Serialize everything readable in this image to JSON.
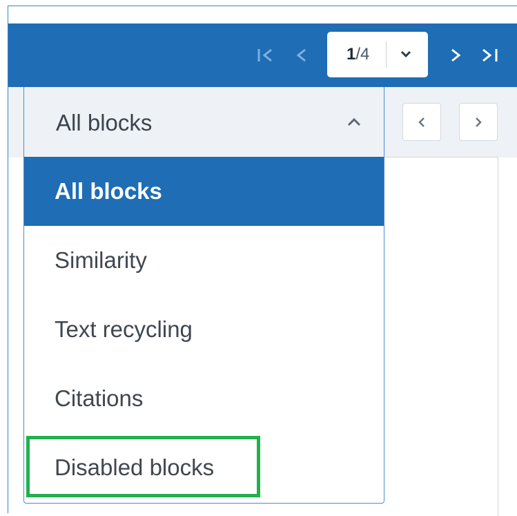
{
  "toolbar": {
    "page_current": "1",
    "page_total": "/4",
    "first_page_icon": "first-page-icon",
    "prev_page_icon": "chevron-left-icon",
    "next_page_icon": "chevron-right-icon",
    "last_page_icon": "last-page-icon",
    "page_dropdown_icon": "chevron-down-icon"
  },
  "block_filter": {
    "selected_label": "All blocks",
    "expanded": true,
    "options": [
      {
        "label": "All blocks",
        "selected": true
      },
      {
        "label": "Similarity",
        "selected": false
      },
      {
        "label": "Text recycling",
        "selected": false
      },
      {
        "label": "Citations",
        "selected": false
      },
      {
        "label": "Disabled blocks",
        "selected": false,
        "highlighted": true
      }
    ]
  },
  "colors": {
    "toolbar_bg": "#1e6db5",
    "selected_option_bg": "#1e6db5",
    "highlight_border": "#22b14c",
    "panel_bg": "#eef2f6"
  }
}
